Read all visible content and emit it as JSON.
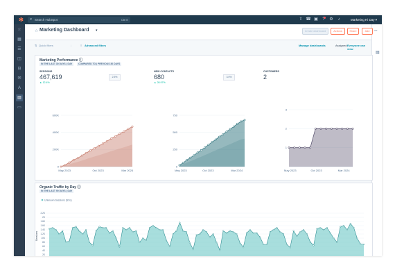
{
  "topbar": {
    "logo_icon": "hubspot-sprocket-icon",
    "search_placeholder": "Search HubSpot",
    "search_shortcut": "Ctrl K",
    "account_label": "Marketing Hi Day"
  },
  "header": {
    "title": "Marketing Dashboard",
    "buttons": [
      "Create dashboard",
      "Actions",
      "Share",
      "Add"
    ]
  },
  "filters": {
    "quick": "Quick filters",
    "advanced": "Advanced filters",
    "manage": "Manage dashboards",
    "assigned_label": "Assigned:",
    "assigned_value": "Everyone can view"
  },
  "marketing_performance": {
    "title": "Marketing Performance",
    "tags": [
      "IN THE LAST 30 DAYS | DAY",
      "COMPARED TO | PREVIOUS 30 DAYS"
    ],
    "kpis": [
      {
        "label": "SESSIONS",
        "value": "467,619",
        "delta": "12.4%",
        "bubble": "2.5%"
      },
      {
        "label": "NEW CONTACTS",
        "value": "680",
        "delta": "28.97%",
        "bubble": "3.0%"
      },
      {
        "label": "CUSTOMERS",
        "value": "2",
        "delta": "",
        "bubble": ""
      }
    ]
  },
  "organic": {
    "title": "Organic Traffic by Day",
    "tag": "IN THE LAST 90 DAYS | DAY",
    "legend": "Unknown Sessions (SSL)",
    "ylabel": "Sessions"
  },
  "colors": {
    "sessions": "#c77e6e",
    "contacts": "#3f7f88",
    "customers": "#5e5873",
    "organic": "#6ec8c6"
  },
  "chart_data": [
    {
      "type": "area",
      "title": "Sessions",
      "categories": [
        "May 2023",
        "Oct 2023",
        "Mar 2024"
      ],
      "ytick_labels": [
        "0",
        "200K",
        "400K",
        "600K"
      ],
      "ylim": [
        0,
        600000
      ],
      "series": [
        {
          "values": [
            0,
            20000,
            48000,
            78000,
            100000,
            130000,
            158000,
            188000,
            215000,
            242000,
            270000,
            298000,
            328000,
            355000,
            385000,
            410000,
            440000,
            467619
          ]
        }
      ]
    },
    {
      "type": "area",
      "title": "New Contacts",
      "categories": [
        "May 2023",
        "Oct 2023",
        "Mar 2024"
      ],
      "ytick_labels": [
        "0",
        "250",
        "500",
        "750"
      ],
      "ylim": [
        0,
        750
      ],
      "series": [
        {
          "values": [
            20,
            55,
            95,
            130,
            165,
            205,
            240,
            280,
            318,
            358,
            395,
            435,
            470,
            510,
            548,
            585,
            625,
            660,
            680
          ]
        }
      ]
    },
    {
      "type": "area",
      "title": "Customers",
      "categories": [
        "May 2023",
        "Oct 2023",
        "Mar 2024"
      ],
      "ytick_labels": [
        "1",
        "2",
        "3"
      ],
      "ylim": [
        0,
        3
      ],
      "series": [
        {
          "values": [
            1,
            1,
            1,
            1,
            1,
            2,
            2,
            2,
            2,
            2,
            2,
            2,
            2
          ]
        }
      ]
    },
    {
      "type": "area",
      "title": "Organic Traffic by Day",
      "ytick_labels": [
        "0",
        "2K",
        "4K",
        "6K",
        "8K",
        "10K",
        "1.2K",
        "1.4K",
        "1.6K",
        "1.8K",
        "2K",
        "2.2K"
      ],
      "ylim": [
        0,
        2200
      ],
      "series": [
        {
          "name": "Unknown Sessions (SSL)",
          "values": [
            1450,
            1500,
            1400,
            1200,
            1350,
            820,
            850,
            1500,
            1550,
            1350,
            1200,
            1400,
            800,
            650,
            1350,
            1550,
            1500,
            1500,
            1250,
            1350,
            1000,
            580,
            1500,
            1400,
            1500,
            1300,
            1350,
            800,
            1000,
            900,
            1500,
            1600,
            1500,
            1400,
            1400,
            900,
            600,
            1200,
            1350,
            1750,
            1350,
            1300,
            780,
            460,
            1150,
            1200,
            1400,
            1300,
            1050,
            1200,
            800,
            420,
            1350,
            1250,
            1350,
            1300,
            1200,
            780,
            560,
            1250,
            1400,
            1250,
            1250,
            1050,
            700,
            700,
            1300,
            1400,
            1500,
            1300,
            1200,
            700,
            550,
            1350,
            1100,
            1300,
            1400,
            1200,
            820,
            650,
            1450,
            1500,
            1400,
            1500,
            1250,
            1000,
            800,
            1550,
            1600,
            1400,
            1700,
            1500,
            1000,
            720,
            700
          ]
        }
      ]
    }
  ]
}
